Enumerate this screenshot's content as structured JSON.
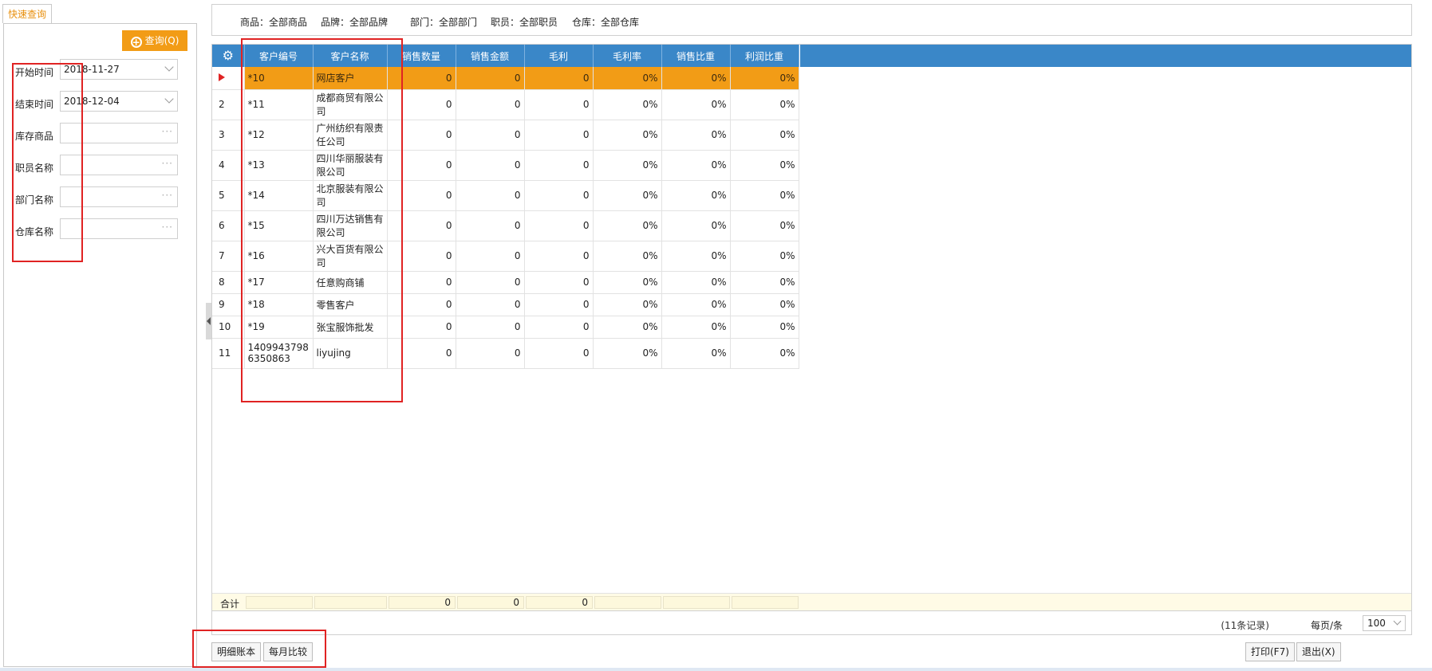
{
  "left_panel": {
    "tab_label": "快速查询",
    "query_button": "查询(Q)",
    "fields": [
      {
        "label": "开始时间",
        "value": "2018-11-27",
        "kind": "date"
      },
      {
        "label": "结束时间",
        "value": "2018-12-04",
        "kind": "date"
      },
      {
        "label": "库存商品",
        "value": "",
        "kind": "picker"
      },
      {
        "label": "职员名称",
        "value": "",
        "kind": "picker"
      },
      {
        "label": "部门名称",
        "value": "",
        "kind": "picker"
      },
      {
        "label": "仓库名称",
        "value": "",
        "kind": "picker"
      }
    ]
  },
  "filter_bar": [
    "商品：全部商品",
    "品牌：全部品牌",
    "部门：全部部门",
    "职员：全部职员",
    "仓库：全部仓库"
  ],
  "grid": {
    "columns": [
      "客户编号",
      "客户名称",
      "销售数量",
      "销售金额",
      "毛利",
      "毛利率",
      "销售比重",
      "利润比重"
    ],
    "rows": [
      {
        "idx": "",
        "code": "*10",
        "name": "网店客户",
        "qty": "0",
        "amount": "0",
        "profit": "0",
        "margin": "0%",
        "sales_share": "0%",
        "profit_share": "0%"
      },
      {
        "idx": "2",
        "code": "*11",
        "name": "成都商贸有限公司",
        "qty": "0",
        "amount": "0",
        "profit": "0",
        "margin": "0%",
        "sales_share": "0%",
        "profit_share": "0%"
      },
      {
        "idx": "3",
        "code": "*12",
        "name": "广州纺织有限责任公司",
        "qty": "0",
        "amount": "0",
        "profit": "0",
        "margin": "0%",
        "sales_share": "0%",
        "profit_share": "0%"
      },
      {
        "idx": "4",
        "code": "*13",
        "name": "四川华丽服装有限公司",
        "qty": "0",
        "amount": "0",
        "profit": "0",
        "margin": "0%",
        "sales_share": "0%",
        "profit_share": "0%"
      },
      {
        "idx": "5",
        "code": "*14",
        "name": "北京服装有限公司",
        "qty": "0",
        "amount": "0",
        "profit": "0",
        "margin": "0%",
        "sales_share": "0%",
        "profit_share": "0%"
      },
      {
        "idx": "6",
        "code": "*15",
        "name": "四川万达销售有限公司",
        "qty": "0",
        "amount": "0",
        "profit": "0",
        "margin": "0%",
        "sales_share": "0%",
        "profit_share": "0%"
      },
      {
        "idx": "7",
        "code": "*16",
        "name": "兴大百货有限公司",
        "qty": "0",
        "amount": "0",
        "profit": "0",
        "margin": "0%",
        "sales_share": "0%",
        "profit_share": "0%"
      },
      {
        "idx": "8",
        "code": "*17",
        "name": "任意购商铺",
        "qty": "0",
        "amount": "0",
        "profit": "0",
        "margin": "0%",
        "sales_share": "0%",
        "profit_share": "0%"
      },
      {
        "idx": "9",
        "code": "*18",
        "name": "零售客户",
        "qty": "0",
        "amount": "0",
        "profit": "0",
        "margin": "0%",
        "sales_share": "0%",
        "profit_share": "0%"
      },
      {
        "idx": "10",
        "code": "*19",
        "name": "张宝服饰批发",
        "qty": "0",
        "amount": "0",
        "profit": "0",
        "margin": "0%",
        "sales_share": "0%",
        "profit_share": "0%"
      },
      {
        "idx": "11",
        "code": "14099437986350863",
        "name": "liyujing",
        "qty": "0",
        "amount": "0",
        "profit": "0",
        "margin": "0%",
        "sales_share": "0%",
        "profit_share": "0%"
      }
    ],
    "totals": {
      "label": "合计",
      "qty": "0",
      "amount": "0",
      "profit": "0"
    }
  },
  "pager": {
    "records": "(11条记录)",
    "per_page_label": "每页/条",
    "per_page_value": "100"
  },
  "buttons": {
    "detail_ledger": "明细账本",
    "monthly_compare": "每月比较",
    "print": "打印(F7)",
    "exit": "退出(X)"
  },
  "colors": {
    "header_blue": "#3a87c8",
    "selected_orange": "#f29c16",
    "annotation_red": "#e02323"
  }
}
